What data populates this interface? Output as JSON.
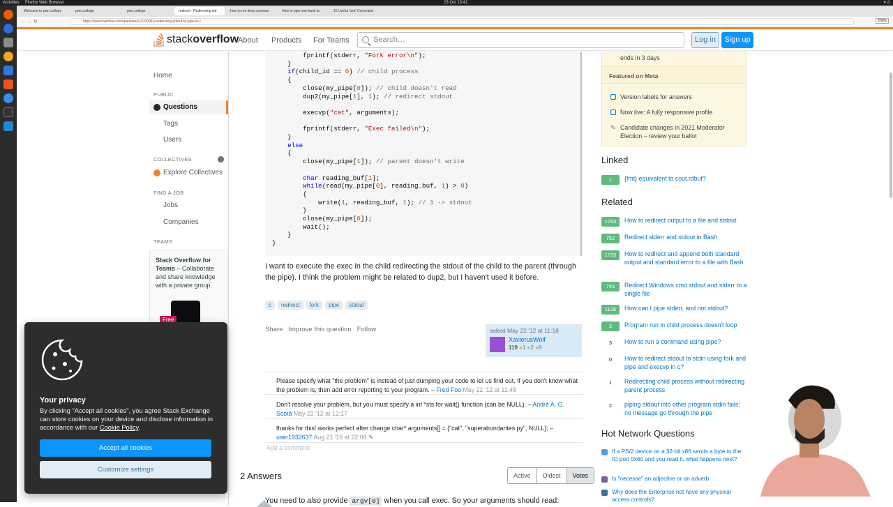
{
  "desktop": {
    "activities": "Activities",
    "app": "Firefox Web Browser",
    "clock": "23 Oct  13:41"
  },
  "browser": {
    "tabs": [
      "Welcome to pwn.college",
      "pwn.college",
      "pwn.college",
      "redirect - Redirecting std",
      "how to run linux comman",
      "How to pipe one bash sc",
      "15 Useful 'sed' Command"
    ],
    "url": "https://stackoverflow.com/questions/10700982/redirecting-stdout-to-pipe-in-c",
    "zoom": "230%"
  },
  "header": {
    "logo_a": "stack",
    "logo_b": "overflow",
    "about": "About",
    "products": "Products",
    "for_teams": "For Teams",
    "search_placeholder": "Search…",
    "login": "Log in",
    "signup": "Sign up"
  },
  "leftnav": {
    "home": "Home",
    "public": "PUBLIC",
    "questions": "Questions",
    "tags": "Tags",
    "users": "Users",
    "collectives": "COLLECTIVES",
    "explore": "Explore Collectives",
    "find_job": "FIND A JOB",
    "jobs": "Jobs",
    "companies": "Companies",
    "teams": "TEAMS",
    "teams_title": "Stack Overflow for Teams",
    "teams_desc": " – Collaborate and share knowledge with a private group.",
    "free": "Free"
  },
  "question": {
    "code_lines": [
      "        fprintf(stderr, \"Fork error\\n\");",
      "    }",
      "    if(child_id == 0) // child process",
      "    {",
      "        close(my_pipe[0]); // child doesn't read",
      "        dup2(my_pipe[1], 1); // redirect stdout",
      "",
      "        execvp(\"cat\", arguments);",
      "",
      "        fprintf(stderr, \"Exec failed\\n\");",
      "    }",
      "    else",
      "    {",
      "        close(my_pipe[1]); // parent doesn't write",
      "",
      "        char reading_buf[1];",
      "        while(read(my_pipe[0], reading_buf, 1) > 0)",
      "        {",
      "            write(1, reading_buf, 1); // 1 -> stdout",
      "        }",
      "        close(my_pipe[0]);",
      "        wait();",
      "    }",
      "}"
    ],
    "body": "I want to execute the exec in the child redirecting the stdout of the child to the parent (through the pipe). I think the problem might be related to dup2, but I haven't used it before.",
    "tags": [
      "c",
      "redirect",
      "fork",
      "pipe",
      "stdout"
    ],
    "menu": [
      "Share",
      "Improve this question",
      "Follow"
    ],
    "asked": "asked May 22 '12 at 11:18",
    "user": "XavierusWolf",
    "rep": "119",
    "gold": "",
    "silver": "1",
    "bronze": "2",
    "bronze2": "9"
  },
  "comments": [
    {
      "text": "Please specify what \"the problem\" is instead of just dumping your code to let us find out. If you don't know what the problem is, then add error reporting to your program. – ",
      "user": "Fred Foo",
      "date": " May 22 '12 at 11:48"
    },
    {
      "text": "Don't resolve your problem, but you must specify a int *sts for wait() function (can be NULL). – ",
      "user": "André A. G. Scotá",
      "date": " May 22 '12 at 12:17"
    },
    {
      "text": "thanks for this! works perfect after change char* arguments[] = {\"cat\", \"superabundantes.py\", NULL}; – ",
      "user": "user1932637",
      "date": " Aug 21 '19 at 22:08"
    }
  ],
  "add_comment": "Add a comment",
  "answers": {
    "count": "2 Answers",
    "sort": [
      "Active",
      "Oldest",
      "Votes"
    ],
    "first_line_a": "You need to ",
    "first_line_em": "also",
    "first_line_b": " provide ",
    "first_line_code": "argv[0]",
    "first_line_c": " when you call exec. So your arguments should read:"
  },
  "sidebar": {
    "ends": "ends in 3 days",
    "featured_meta": "Featured on Meta",
    "meta_items": [
      "Version labels for answers",
      "Now live: A fully responsive profile",
      "Candidate changes in 2021 Moderator Election – review your ballot"
    ],
    "linked_title": "Linked",
    "linked": [
      {
        "score": "1",
        "text": "{fmt} equivalent to cout.rdbuf?"
      }
    ],
    "related_title": "Related",
    "related": [
      {
        "score": "1253",
        "text": "How to redirect output to a file and stdout"
      },
      {
        "score": "752",
        "text": "Redirect stderr and stdout in Bash"
      },
      {
        "score": "1725",
        "text": "How to redirect and append both standard output and standard error to a file with Bash"
      },
      {
        "score": "745",
        "text": "Redirect Windows cmd stdout and stderr to a single file"
      },
      {
        "score": "1128",
        "text": "How can I pipe stderr, and not stdout?"
      },
      {
        "score": "3",
        "text": "Program run in child process doesn't loop"
      },
      {
        "score": "3",
        "text": "How to run a command using pipe?"
      },
      {
        "score": "0",
        "text": "How to redirect stdout to stdin using fork and pipe and execvp in c?"
      },
      {
        "score": "1",
        "text": "Redirecting child process without redirecting parent process"
      },
      {
        "score": "2",
        "text": "piping stdout into other program stdin fails; no message go through the pipe"
      }
    ],
    "hnq_title": "Hot Network Questions",
    "hnq": [
      "If a PS/2 device on a 32-bit x86 sends a byte to the IO port 0x60 and you read it, what happens next?",
      "Is \"necesse\" an adjective or an adverb",
      "Why does the Enterprise not have any physical access controls?"
    ]
  },
  "cookie": {
    "title": "Your privacy",
    "text": "By clicking \"Accept all cookies\", you agree Stack Exchange can store cookies on your device and disclose information in accordance with our ",
    "policy": "Cookie Policy",
    "end": ".",
    "accept": "Accept all cookies",
    "customize": "Customize settings"
  },
  "colors": {
    "accent": "#f48225",
    "link": "#0074cc",
    "primary": "#0a95ff",
    "accepted": "#5eba7d"
  }
}
